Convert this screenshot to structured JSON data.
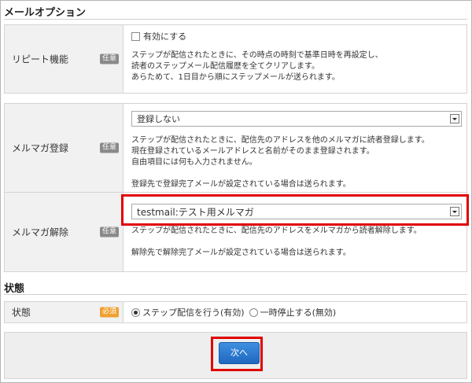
{
  "mail_options": {
    "title": "メールオプション",
    "repeat": {
      "label": "リピート機能",
      "badge": "任意",
      "checkbox_label": "有効にする",
      "checked": false,
      "desc": [
        "ステップが配信されたときに、その時点の時刻で基準日時を再設定し、",
        "読者のステップメール配信履歴を全てクリアします。",
        "あらためて、1日目から順にステップメールが送られます。"
      ]
    },
    "subscribe": {
      "label": "メルマガ登録",
      "badge": "任意",
      "select_value": "登録しない",
      "desc": [
        "ステップが配信されたときに、配信先のアドレスを他のメルマガに読者登録します。",
        "現在登録されているメールアドレスと名前がそのまま登録されます。",
        "自由項目には何も入力されません。",
        "",
        "登録先で登録完了メールが設定されている場合は送られます。"
      ]
    },
    "unsubscribe": {
      "label": "メルマガ解除",
      "badge": "任意",
      "select_value": "testmail:テスト用メルマガ",
      "desc": [
        "ステップが配信されたときに、配信先のアドレスをメルマガから読者解除します。",
        "",
        "解除先で解除完了メールが設定されている場合は送られます。"
      ]
    }
  },
  "status": {
    "title": "状態",
    "label": "状態",
    "badge": "必須",
    "options": [
      "ステップ配信を行う(有効)",
      "一時停止する(無効)"
    ],
    "selected_index": 0
  },
  "footer": {
    "next_label": "次へ"
  },
  "colors": {
    "highlight": "#e00000",
    "button": "#1f68c0",
    "required_badge": "#f0a030",
    "optional_badge": "#8a8a8a"
  }
}
